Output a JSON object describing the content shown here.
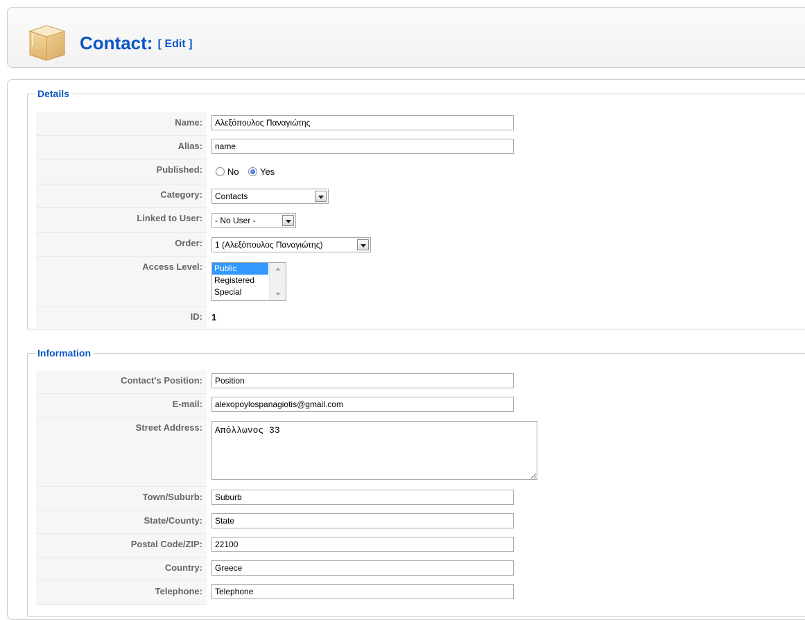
{
  "header": {
    "title": "Contact:",
    "edit_label": "[ Edit ]"
  },
  "details": {
    "legend": "Details",
    "name_label": "Name:",
    "name_value": "Αλεξόπουλος Παναγιώτης",
    "alias_label": "Alias:",
    "alias_value": "name",
    "published_label": "Published:",
    "published_no": "No",
    "published_yes": "Yes",
    "published_selected": "Yes",
    "category_label": "Category:",
    "category_value": "Contacts",
    "linked_label": "Linked to User:",
    "linked_value": "- No User -",
    "order_label": "Order:",
    "order_value": "1 (Αλεξόπουλος Παναγιώτης)",
    "access_label": "Access Level:",
    "access_options": [
      "Public",
      "Registered",
      "Special"
    ],
    "access_selected": "Public",
    "id_label": "ID:",
    "id_value": "1"
  },
  "information": {
    "legend": "Information",
    "position_label": "Contact's Position:",
    "position_value": "Position",
    "email_label": "E-mail:",
    "email_value": "alexopoylospanagiotis@gmail.com",
    "street_label": "Street Address:",
    "street_value": "Απόλλωνος 33",
    "suburb_label": "Town/Suburb:",
    "suburb_value": "Suburb",
    "state_label": "State/County:",
    "state_value": "State",
    "postal_label": "Postal Code/ZIP:",
    "postal_value": "22100",
    "country_label": "Country:",
    "country_value": "Greece",
    "telephone_label": "Telephone:",
    "telephone_value": "Telephone"
  },
  "colors": {
    "accent": "#0b55c4",
    "label_bg": "#f6f6f6",
    "border": "#cccccc"
  },
  "icons": {
    "header": "box-icon"
  }
}
